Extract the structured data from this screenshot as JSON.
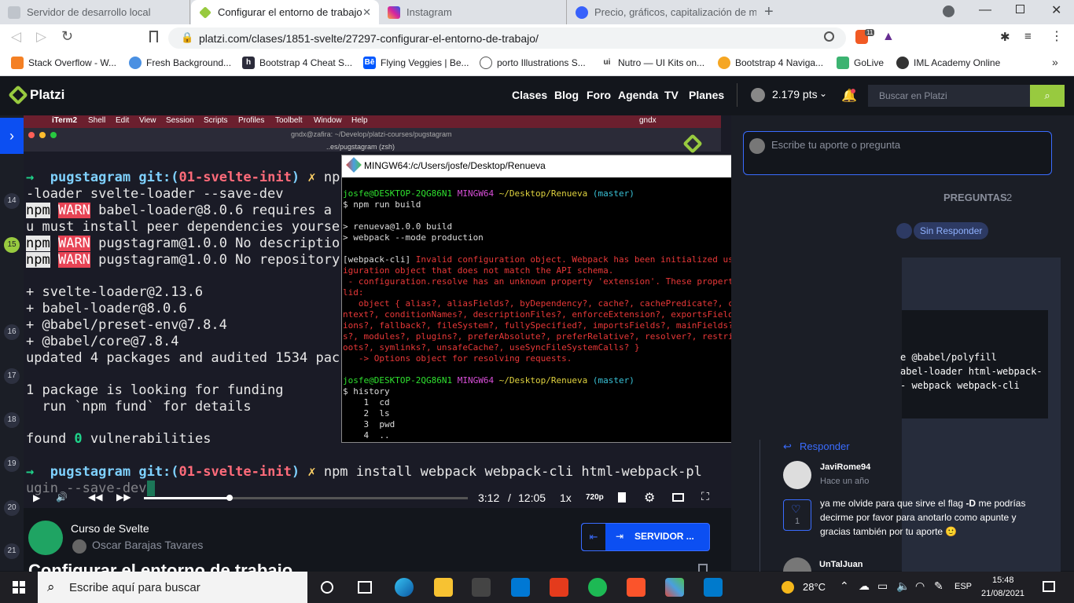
{
  "browser": {
    "tabs": [
      {
        "title": "Servidor de desarrollo local"
      },
      {
        "title": "Configurar el entorno de trabajo"
      },
      {
        "title": "Instagram"
      },
      {
        "title": "Precio, gráficos, capitalización de mer"
      }
    ],
    "url": "platzi.com/clases/1851-svelte/27297-configurar-el-entorno-de-trabajo/",
    "brave_count": "11",
    "bookmarks": [
      "Stack Overflow - W...",
      "Fresh Background...",
      "Bootstrap 4 Cheat S...",
      "Flying Veggies | Be...",
      "porto Illustrations S...",
      "Nutro — UI Kits on...",
      "Bootstrap 4 Naviga...",
      "GoLive",
      "IML Academy Online"
    ]
  },
  "platzi": {
    "logo": "Platzi",
    "nav": [
      "Clases",
      "Blog",
      "Foro",
      "Agenda",
      "TV",
      "Planes"
    ],
    "points": "2.179 pts",
    "search_placeholder": "Buscar en Platzi"
  },
  "video": {
    "mac_menu": [
      "iTerm2",
      "Shell",
      "Edit",
      "View",
      "Session",
      "Scripts",
      "Profiles",
      "Toolbelt",
      "Window",
      "Help"
    ],
    "mac_user": "gndx",
    "term_title": "gndx@zafira: ~/Develop/platzi-courses/pugstagram",
    "term_subtitle": "..es/pugstagram (zsh)",
    "time_current": "3:12",
    "time_total": "12:05",
    "speed": "1x",
    "quality": "720p",
    "timeline_numbers": [
      "14",
      "15",
      "16",
      "17",
      "18",
      "19",
      "20",
      "21"
    ],
    "terminal_lines": {
      "l1_repo": "pugstagram",
      "l1_git": "git:(",
      "l1_branch": "01-svelte-init",
      "l1_end": ")",
      "l1_x": "✗",
      "l1_cmd": "np",
      "l2": "-loader svelte-loader --save-dev",
      "l3_rest": "babel-loader@8.0.6 requires a",
      "l4": "u must install peer dependencies yourse",
      "l5_rest": "pugstagram@1.0.0 No descriptio",
      "l6_rest": "pugstagram@1.0.0 No repository",
      "l7": "+ svelte-loader@2.13.6",
      "l8": "+ babel-loader@8.0.6",
      "l9": "+ @babel/preset-env@7.8.4",
      "l10": "+ @babel/core@7.8.4",
      "l11": "updated 4 packages and audited 1534 pac",
      "l12": "1 package is looking for funding",
      "l13": "  run `npm fund` for details",
      "l14a": "found ",
      "l14b": "0",
      "l14c": " vulnerabilities",
      "l15_cmd": "npm install webpack webpack-cli html-webpack-pl",
      "l16": "ugin --save-dev",
      "npm": "npm",
      "warn": "WARN",
      "arrow": "→"
    }
  },
  "mingw": {
    "title": "MINGW64:/c/Users/josfe/Desktop/Renueva",
    "prompt_user": "josfe@DESKTOP-2QG86N1",
    "prompt_env": "MINGW64",
    "prompt_path": "~/Desktop/Renueva",
    "prompt_branch": "(master)",
    "cmd1": "$ npm run build",
    "out1": "> renueva@1.0.0 build",
    "out2": "> webpack --mode production",
    "err_tag": "[webpack-cli]",
    "err1": " Invalid configuration object. Webpack has been initialized using a conf",
    "err2": "iguration object that does not match the API schema.",
    "err3": " - configuration.resolve has an unknown property 'extension'. These properties are va",
    "err4": "lid:",
    "err5": "   object { alias?, aliasFields?, byDependency?, cache?, cachePredicate?, cacheWithCo",
    "err6": "ntext?, conditionNames?, descriptionFiles?, enforceExtension?, exportsFields?, extens",
    "err7": "ions?, fallback?, fileSystem?, fullySpecified?, importsFields?, mainFields?, mainFile",
    "err8": "s?, modules?, plugins?, preferAbsolute?, preferRelative?, resolver?, restrictions?, r",
    "err9": "oots?, symlinks?, unsafeCache?, useSyncFileSystemCalls? }",
    "err10": "   -> Options object for resolving requests.",
    "cmd2": "$ history",
    "h1": "    1  cd",
    "h2": "    2  ls",
    "h3": "    3  pwd",
    "h4": "    4  .."
  },
  "course": {
    "name": "Curso de Svelte",
    "teacher": "Oscar Barajas Tavares",
    "next_button": "SERVIDOR ...",
    "class_title": "Configurar el entorno de trabajo"
  },
  "comments": {
    "input_placeholder": "Escribe tu aporte o pregunta",
    "tab_questions": "PREGUNTAS",
    "questions_count": "2",
    "filter": "Sin Responder",
    "code_l1": "e @babel/polyfill",
    "code_l2": "abel-loader html-webpack-",
    "code_l3": "- webpack webpack-cli",
    "reply_label": "Responder",
    "user1": "JaviRome94",
    "time1": "Hace un año",
    "likes1": "1",
    "text1_a": "ya me olvide para que sirve el flag ",
    "text1_b": "-D",
    "text1_c": " me podrías decirme por favor para anotarlo como apunte y gracias también por tu aporte 🙂",
    "user2": "UnTalJuan"
  },
  "taskbar": {
    "search_placeholder": "Escribe aquí para buscar",
    "temp": "28°C",
    "lang": "ESP",
    "time": "15:48",
    "date": "21/08/2021"
  },
  "colors": {
    "platzi_green": "#98ca3f",
    "blue_button": "#0c4ff2",
    "term_bg": "#1a1b26"
  }
}
